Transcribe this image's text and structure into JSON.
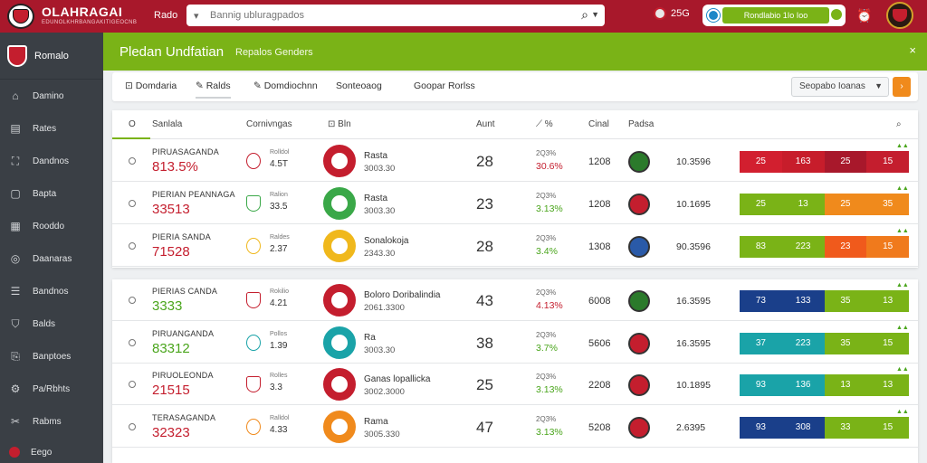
{
  "topbar": {
    "brand": "OLAHRAGAI",
    "brand_sub": "EDUNOLKHRBANGAKITIGEOCNB",
    "link": "Rado",
    "search_placeholder": "Bannig ubluragpados",
    "score": "25G",
    "pill_text": "Rondlabio 1Io Ioo"
  },
  "sidebar": {
    "header": "Romalo",
    "items": [
      {
        "label": "Damino",
        "icon": "home-icon"
      },
      {
        "label": "Rates",
        "icon": "chart-icon"
      },
      {
        "label": "Dandnos",
        "icon": "network-icon"
      },
      {
        "label": "Bapta",
        "icon": "doc-icon"
      },
      {
        "label": "Rooddo",
        "icon": "grid-icon"
      },
      {
        "label": "Daanaras",
        "icon": "globe-icon"
      },
      {
        "label": "Bandnos",
        "icon": "list-icon"
      },
      {
        "label": "Balds",
        "icon": "shield-icon"
      },
      {
        "label": "Banptoes",
        "icon": "bookmark-icon"
      },
      {
        "label": "Pa/Rbhts",
        "icon": "gear-icon"
      },
      {
        "label": "Rabms",
        "icon": "tool-icon"
      }
    ],
    "footer": "Eego"
  },
  "header": {
    "title": "Pledan Undfatian",
    "subtitle": "Repalos Genders",
    "close": "×"
  },
  "filters": {
    "items": [
      "Domdaria",
      "Ralds",
      "Domdiochnn",
      "Sonteoaog",
      "Goopar Rorlss"
    ],
    "select": "Seopabo Ioanas",
    "btn": "›"
  },
  "table": {
    "headers": [
      "Sanlala",
      "Cornivngas",
      "Bln",
      "Aunt",
      "%",
      "Cinal",
      "Padsa"
    ],
    "radio_header": "O",
    "rows": [
      {
        "name": "PIRUASAGANDA",
        "value": "813.5%",
        "vcol": "red",
        "sm": "Rolldol",
        "smn": "4.5T",
        "cname": "Rasta",
        "cnum": "3003.30",
        "big": "28",
        "pct_top": "2Q3%",
        "pct": "30.6%",
        "pcol": "red",
        "cnt": "1208",
        "ratio": "10.3596",
        "bars": [
          "25",
          "163",
          "25",
          "15"
        ],
        "clr": [
          "#d21f2f",
          "#c71d2b",
          "#a8182b",
          "#c41e2e"
        ],
        "club": "#c41e2e",
        "mlogo": "#2b7a2b"
      },
      {
        "name": "PIERIAN PEANNAGA",
        "value": "33513",
        "vcol": "red",
        "sm": "Ralion",
        "smn": "33.5",
        "cname": "Rasta",
        "cnum": "3003.30",
        "big": "23",
        "pct_top": "2Q3%",
        "pct": "3.13%",
        "pcol": "green",
        "cnt": "1208",
        "ratio": "10.1695",
        "bars": [
          "25",
          "13",
          "25",
          "35"
        ],
        "clr": [
          "#7ab317",
          "#7ab317",
          "#f08a1c",
          "#f08a1c"
        ],
        "club": "#3aa848",
        "mlogo": "#c41e2e"
      },
      {
        "name": "PIERIA SANDA",
        "value": "71528",
        "vcol": "red",
        "sm": "Raldes",
        "smn": "2.37",
        "cname": "Sonalokoja",
        "cnum": "2343.30",
        "big": "28",
        "pct_top": "2Q3%",
        "pct": "3.4%",
        "pcol": "green",
        "cnt": "1308",
        "ratio": "90.3596",
        "bars": [
          "83",
          "223",
          "23",
          "15"
        ],
        "clr": [
          "#7ab317",
          "#7ab317",
          "#f05a1c",
          "#f07a1c"
        ],
        "club": "#f0b81c",
        "mlogo": "#2a5aa8"
      },
      {
        "name": "PIERIAS CANDA",
        "value": "3333",
        "vcol": "green",
        "sm": "Rokilio",
        "smn": "4.21",
        "cname": "Boloro Doribalindia",
        "cnum": "2061.3300",
        "big": "43",
        "pct_top": "2Q3%",
        "pct": "4.13%",
        "pcol": "red",
        "cnt": "6008",
        "ratio": "16.3595",
        "bars": [
          "73",
          "133",
          "35",
          "13"
        ],
        "clr": [
          "#1a3f8a",
          "#1a3f8a",
          "#7ab317",
          "#7ab317"
        ],
        "club": "#c41e2e",
        "mlogo": "#2b7a2b"
      },
      {
        "name": "PIRUANGANDA",
        "value": "83312",
        "vcol": "green",
        "sm": "Pollos",
        "smn": "1.39",
        "cname": "Ra",
        "cnum": "3003.30",
        "big": "38",
        "pct_top": "2Q3%",
        "pct": "3.7%",
        "pcol": "green",
        "cnt": "5606",
        "ratio": "16.3595",
        "bars": [
          "37",
          "223",
          "35",
          "15"
        ],
        "clr": [
          "#1aa3a8",
          "#1aa3a8",
          "#7ab317",
          "#7ab317"
        ],
        "club": "#1aa3a8",
        "mlogo": "#c41e2e"
      },
      {
        "name": "PIRUOLEONDA",
        "value": "21515",
        "vcol": "red",
        "sm": "Rolles",
        "smn": "3.3",
        "cname": "Ganas lopallicka",
        "cnum": "3002.3000",
        "big": "25",
        "pct_top": "2Q3%",
        "pct": "3.13%",
        "pcol": "green",
        "cnt": "2208",
        "ratio": "10.1895",
        "bars": [
          "93",
          "136",
          "13",
          "13"
        ],
        "clr": [
          "#1aa3a8",
          "#1aa3a8",
          "#7ab317",
          "#7ab317"
        ],
        "club": "#c41e2e",
        "mlogo": "#c41e2e"
      },
      {
        "name": "TERASAGANDA",
        "value": "32323",
        "vcol": "red",
        "sm": "Ralldol",
        "smn": "4.33",
        "cname": "Rama",
        "cnum": "3005.330",
        "big": "47",
        "pct_top": "2Q3%",
        "pct": "3.13%",
        "pcol": "green",
        "cnt": "5208",
        "ratio": "2.6395",
        "bars": [
          "93",
          "308",
          "33",
          "15"
        ],
        "clr": [
          "#1a3f8a",
          "#1a3f8a",
          "#7ab317",
          "#7ab317"
        ],
        "club": "#f08a1c",
        "mlogo": "#c41e2e"
      }
    ]
  }
}
